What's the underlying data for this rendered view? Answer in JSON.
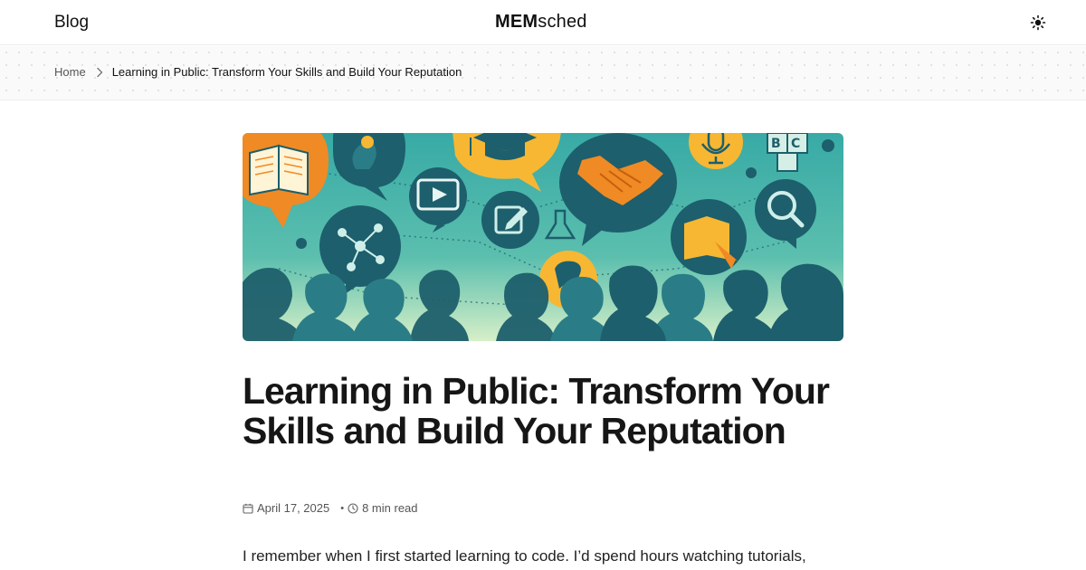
{
  "header": {
    "blog_label": "Blog",
    "logo_bold": "MEM",
    "logo_light": "sched",
    "theme_icon": "sun-icon"
  },
  "breadcrumb": {
    "home": "Home",
    "separator_icon": "chevron-right-icon",
    "current": "Learning in Public: Transform Your Skills and Build Your Reputation"
  },
  "hero": {
    "icons": [
      "open-book-icon",
      "lightbulb-head-icon",
      "video-play-icon",
      "graduation-cap-icon",
      "handshake-icon",
      "microphone-icon",
      "abc-blocks-icon",
      "network-brain-icon",
      "edit-icon",
      "flask-icon",
      "magnifier-icon",
      "reading-book-icon",
      "chat-icon",
      "gear-icon"
    ],
    "colors": {
      "teal": "#3fb3ad",
      "dark_teal": "#1d5f6c",
      "orange": "#f08a24",
      "yellow": "#f7b733",
      "mint": "#c9ecd2"
    }
  },
  "article": {
    "title": "Learning in Public: Transform Your Skills and Build Your Reputation",
    "date": "April 17, 2025",
    "read_time": "8 min read",
    "date_icon": "calendar-icon",
    "time_icon": "clock-icon",
    "lead": "I remember when I first started learning to code. I’d spend hours watching tutorials,"
  }
}
